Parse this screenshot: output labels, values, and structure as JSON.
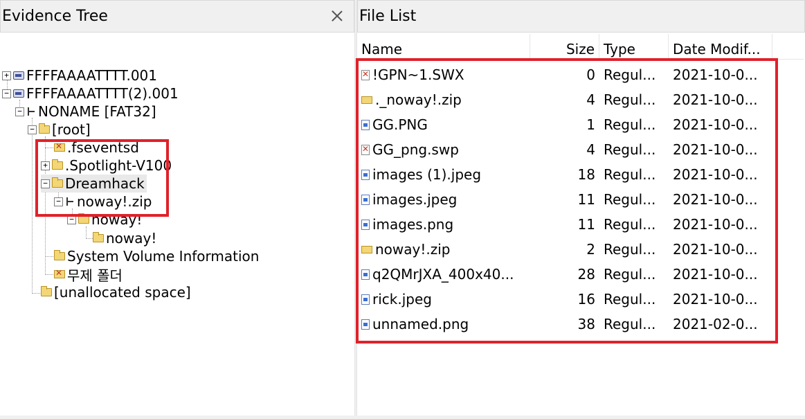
{
  "evidence_tree": {
    "title": "Evidence Tree",
    "nodes": [
      {
        "label": "FFFFAAAATTTT.001",
        "expander": "+",
        "icon": "drive-icon"
      },
      {
        "label": "FFFFAAAATTTT(2).001",
        "expander": "−",
        "icon": "drive-icon"
      },
      {
        "label": "NONAME [FAT32]",
        "expander": "−",
        "icon": "filesystem-icon"
      },
      {
        "label": "[root]",
        "expander": "−",
        "icon": "folder-icon"
      },
      {
        "label": ".fseventsd",
        "expander": "",
        "icon": "deleted-folder-icon"
      },
      {
        "label": ".Spotlight-V100",
        "expander": "+",
        "icon": "folder-icon"
      },
      {
        "label": "Dreamhack",
        "expander": "−",
        "icon": "folder-icon"
      },
      {
        "label": "noway!.zip",
        "expander": "−",
        "icon": "filesystem-icon"
      },
      {
        "label": "noway!",
        "expander": "−",
        "icon": "folder-icon"
      },
      {
        "label": "noway!",
        "expander": "",
        "icon": "folder-icon"
      },
      {
        "label": "System Volume Information",
        "expander": "",
        "icon": "folder-icon"
      },
      {
        "label": "무제 폴더",
        "expander": "",
        "icon": "deleted-folder-icon"
      },
      {
        "label": "[unallocated space]",
        "expander": "",
        "icon": "folder-icon"
      }
    ]
  },
  "file_list": {
    "title": "File List",
    "columns": {
      "name": "Name",
      "size": "Size",
      "type": "Type",
      "date": "Date Modif..."
    },
    "rows": [
      {
        "name": "!GPN~1.SWX",
        "size": "0",
        "type": "Regul...",
        "date": "2021-10-0...",
        "icon": "deleted-file-icon"
      },
      {
        "name": "._noway!.zip",
        "size": "4",
        "type": "Regul...",
        "date": "2021-10-0...",
        "icon": "zip-folder-icon"
      },
      {
        "name": "GG.PNG",
        "size": "1",
        "type": "Regul...",
        "date": "2021-10-0...",
        "icon": "file-icon"
      },
      {
        "name": "GG_png.swp",
        "size": "4",
        "type": "Regul...",
        "date": "2021-10-0...",
        "icon": "deleted-file-icon"
      },
      {
        "name": "images (1).jpeg",
        "size": "18",
        "type": "Regul...",
        "date": "2021-10-0...",
        "icon": "file-icon"
      },
      {
        "name": "images.jpeg",
        "size": "11",
        "type": "Regul...",
        "date": "2021-10-0...",
        "icon": "file-icon"
      },
      {
        "name": "images.png",
        "size": "11",
        "type": "Regul...",
        "date": "2021-10-0...",
        "icon": "file-icon"
      },
      {
        "name": "noway!.zip",
        "size": "2",
        "type": "Regul...",
        "date": "2021-10-0...",
        "icon": "zip-folder-icon"
      },
      {
        "name": "q2QMrJXA_400x40...",
        "size": "28",
        "type": "Regul...",
        "date": "2021-10-0...",
        "icon": "file-icon"
      },
      {
        "name": "rick.jpeg",
        "size": "16",
        "type": "Regul...",
        "date": "2021-10-0...",
        "icon": "file-icon"
      },
      {
        "name": "unnamed.png",
        "size": "38",
        "type": "Regul...",
        "date": "2021-02-0...",
        "icon": "file-icon"
      }
    ]
  },
  "colors": {
    "highlight": "#e0212a",
    "header_bg": "#f0f0f0"
  }
}
